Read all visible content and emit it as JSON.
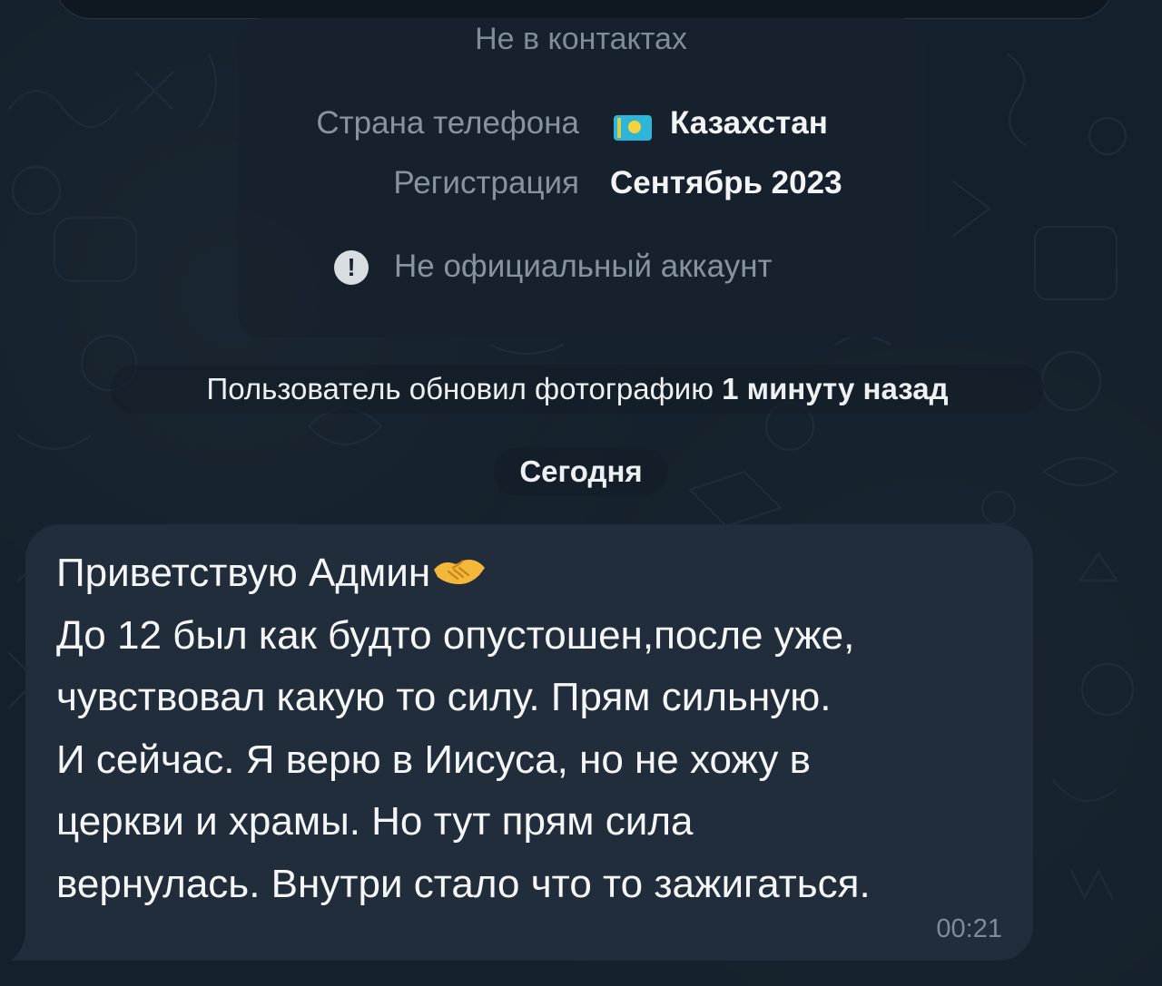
{
  "profile_info": {
    "contact_status": "Не в контактах",
    "phone_country_label": "Страна телефона",
    "phone_country_value": "Казахстан",
    "registration_label": "Регистрация",
    "registration_value": "Сентябрь 2023",
    "official_notice": "Не официальный аккаунт"
  },
  "service_message": {
    "text": "Пользователь обновил фотографию",
    "time_ago": "1 минуту назад"
  },
  "date_separator": "Сегодня",
  "message": {
    "lines": [
      "Приветствую Админ",
      "До 12 был как будто опустошен,после уже,",
      "чувствовал какую то силу. Прям сильную.",
      "И сейчас. Я верю в Иисуса, но не хожу в",
      "церкви и храмы. Но тут прям сила",
      "вернулась. Внутри стало что то зажигаться."
    ],
    "emoji": "handshake-emoji",
    "time": "00:21"
  },
  "colors": {
    "background": "#14202b",
    "bubble": "#212d3b",
    "secondary_text": "#8893a0",
    "primary_text": "#f2f4f6"
  },
  "icons": {
    "flag": "kazakhstan-flag-icon",
    "warning": "exclamation-icon"
  }
}
